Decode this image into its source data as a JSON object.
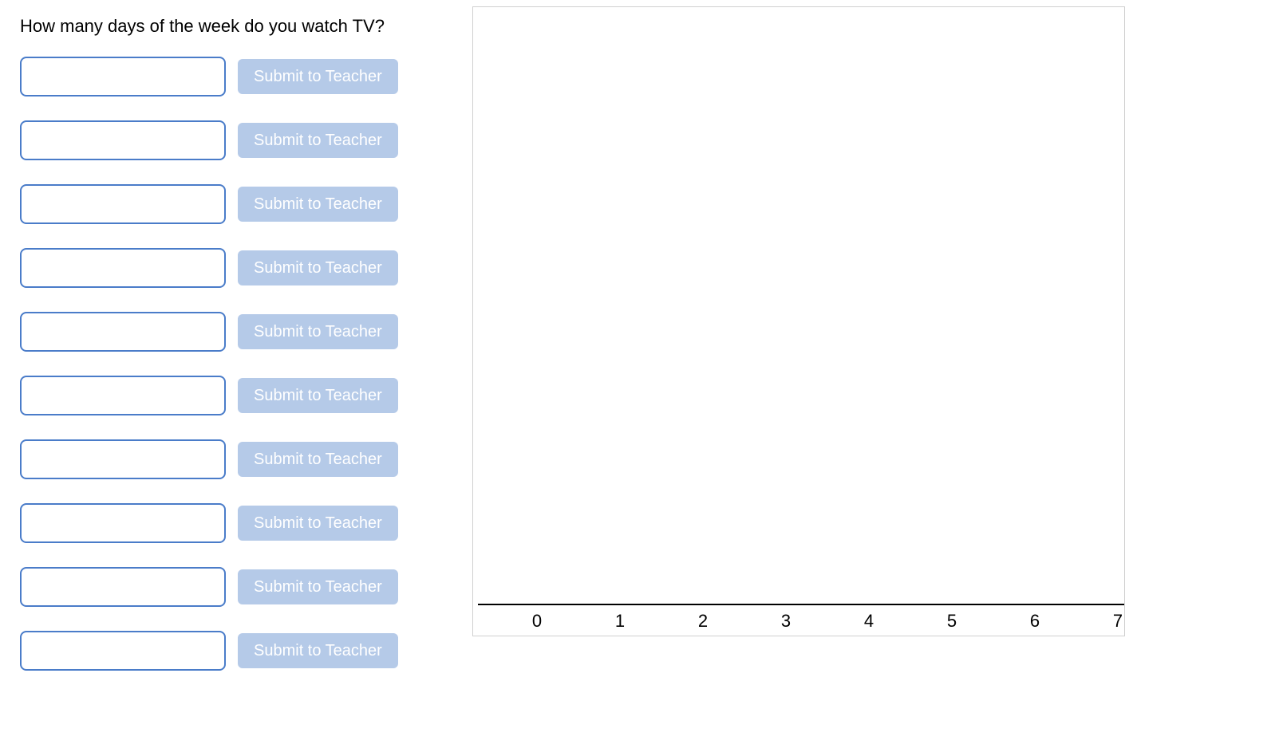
{
  "question": "How many days of the week do you watch TV?",
  "submit_label": "Submit to Teacher",
  "rows": [
    {
      "value": ""
    },
    {
      "value": ""
    },
    {
      "value": ""
    },
    {
      "value": ""
    },
    {
      "value": ""
    },
    {
      "value": ""
    },
    {
      "value": ""
    },
    {
      "value": ""
    },
    {
      "value": ""
    },
    {
      "value": ""
    }
  ],
  "chart_data": {
    "type": "bar",
    "categories": [
      "0",
      "1",
      "2",
      "3",
      "4",
      "5",
      "6",
      "7"
    ],
    "values": [
      0,
      0,
      0,
      0,
      0,
      0,
      0,
      0
    ],
    "title": "",
    "xlabel": "",
    "ylabel": "",
    "xlim": [
      0,
      7
    ]
  }
}
